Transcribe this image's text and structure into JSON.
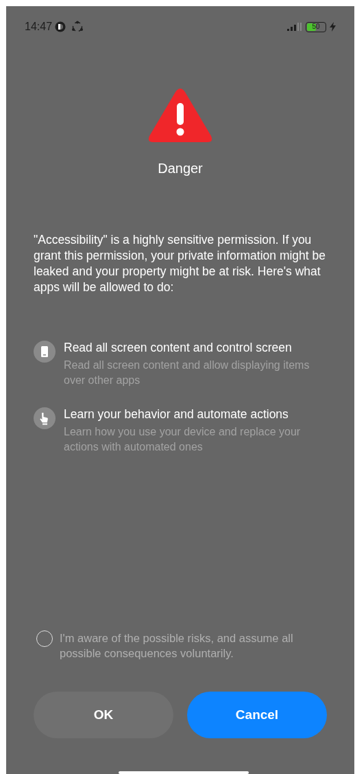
{
  "status_bar": {
    "time": "14:47",
    "battery": {
      "text": "50",
      "level": 0.5
    }
  },
  "title": "Danger",
  "message": "\"Accessibility\" is a highly sensitive permission. If you grant this permission, your private information might be leaked and your property might be at risk. Here's what apps will be allowed to do:",
  "permissions": [
    {
      "kind": "phone",
      "title": "Read all screen content and control screen",
      "description": "Read all screen content and allow displaying items over other apps"
    },
    {
      "kind": "hand",
      "title": "Learn your behavior and automate actions",
      "description": "Learn how you use your device and replace your actions with automated ones"
    }
  ],
  "consent": {
    "text": "I'm aware of the possible risks, and assume all possible consequences voluntarily.",
    "checked": false
  },
  "buttons": [
    {
      "label": "OK",
      "kind": "secondary"
    },
    {
      "label": "Cancel",
      "kind": "primary"
    }
  ]
}
